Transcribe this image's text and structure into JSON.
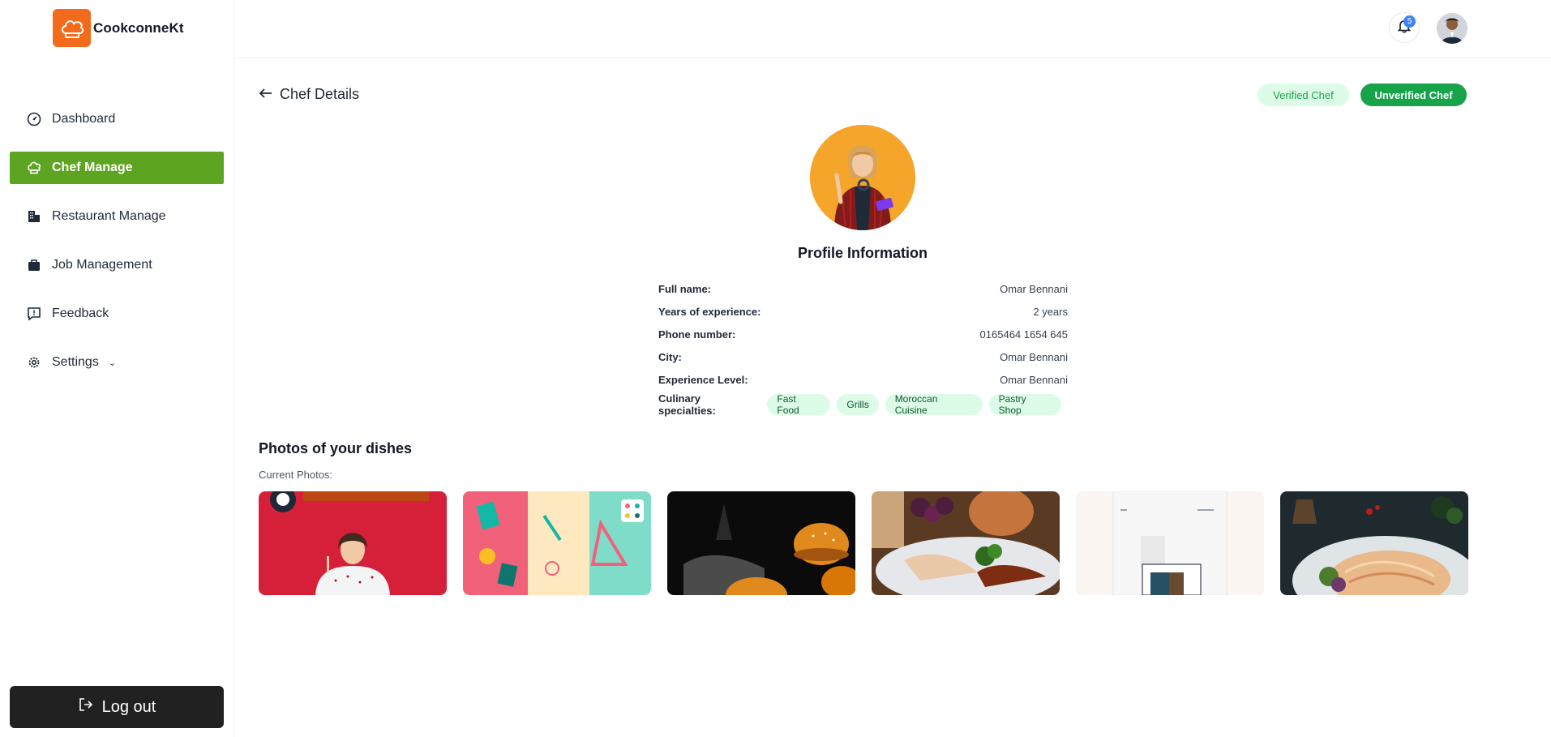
{
  "app": {
    "name": "CookconneKt"
  },
  "sidebar": {
    "items": [
      {
        "label": "Dashboard",
        "icon": "gauge-icon"
      },
      {
        "label": "Chef Manage",
        "icon": "chef-hat-icon"
      },
      {
        "label": "Restaurant Manage",
        "icon": "building-icon"
      },
      {
        "label": "Job Management",
        "icon": "briefcase-icon"
      },
      {
        "label": "Feedback",
        "icon": "feedback-icon"
      },
      {
        "label": "Settings",
        "icon": "gear-icon"
      }
    ],
    "logout_label": "Log out"
  },
  "header": {
    "notification_count": "5"
  },
  "page": {
    "back_label": "Chef Details",
    "verified_label": "Verified Chef",
    "unverified_label": "Unverified Chef",
    "profile_title": "Profile Information"
  },
  "profile": {
    "rows": [
      {
        "label": "Full name:",
        "value": "Omar Bennani"
      },
      {
        "label": "Years of experience:",
        "value": "2 years"
      },
      {
        "label": "Phone number:",
        "value": "0165464 1654 645"
      },
      {
        "label": "City:",
        "value": "Omar Bennani"
      },
      {
        "label": "Experience Level:",
        "value": "Omar Bennani"
      }
    ],
    "specialties_label": "Culinary specialties:",
    "specialties": [
      "Fast Food",
      "Grills",
      "Moroccan Cuisine",
      "Pastry Shop"
    ]
  },
  "photos": {
    "title": "Photos of your dishes",
    "subtitle": "Current Photos:"
  },
  "colors": {
    "brand": "#f26b1d",
    "active_nav": "#5ea423",
    "green": "#16a34a",
    "green_light": "#dcfce7"
  }
}
